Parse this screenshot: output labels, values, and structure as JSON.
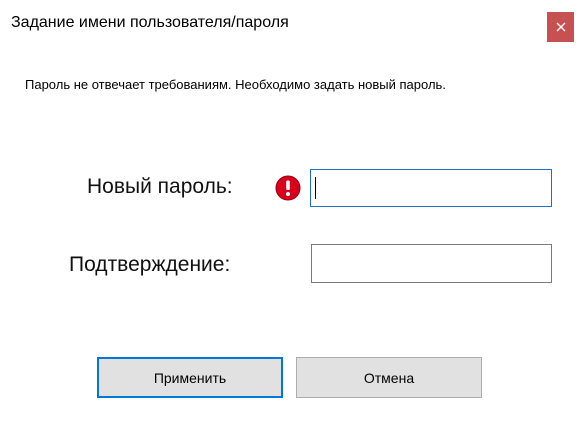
{
  "window": {
    "title": "Задание имени пользователя/пароля",
    "close_icon": "close-icon",
    "close_color": "#c75050"
  },
  "message": "Пароль не отвечает требованиям. Необходимо задать новый пароль.",
  "fields": {
    "new_password": {
      "label": "Новый пароль:",
      "value": "",
      "status_icon": "error-icon",
      "status_color": "#d8001b"
    },
    "confirm": {
      "label": "Подтверждение:",
      "value": ""
    }
  },
  "buttons": {
    "apply_label": "Применить",
    "cancel_label": "Отмена"
  },
  "accent_color": "#0078d7"
}
